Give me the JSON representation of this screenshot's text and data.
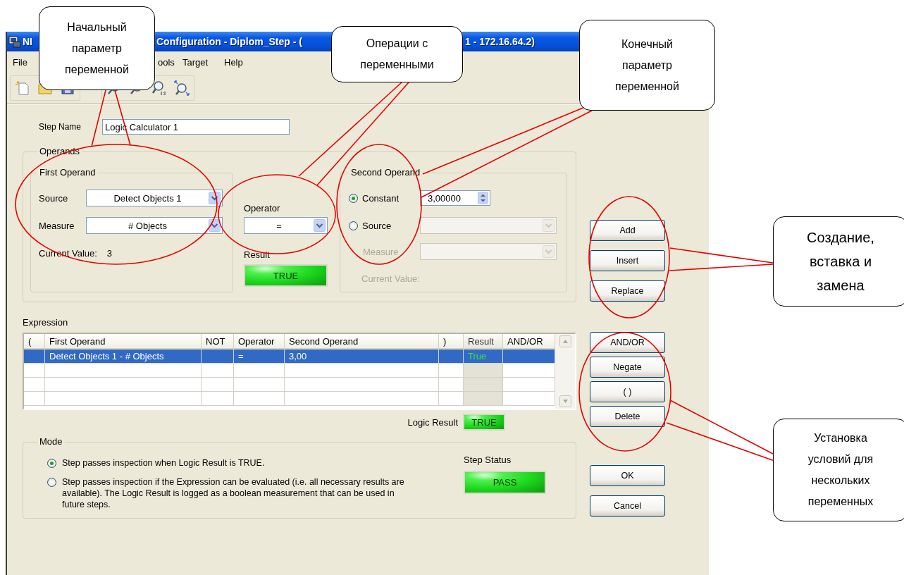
{
  "window": {
    "title_parts": [
      "NI",
      "Configuration - Diplom_Step - (",
      "1 - 172.16.64.2)"
    ]
  },
  "menu": [
    "File",
    "ools",
    "Target",
    "Help"
  ],
  "step_name": {
    "label": "Step Name",
    "value": "Logic Calculator 1"
  },
  "operands": {
    "title": "Operands",
    "first_operand": {
      "title": "First Operand",
      "source": {
        "label": "Source",
        "value": "Detect Objects 1"
      },
      "measure": {
        "label": "Measure",
        "value": "# Objects"
      },
      "current_value": {
        "label": "Current Value:",
        "value": "3"
      }
    },
    "operator": {
      "label": "Operator",
      "value": "="
    },
    "result": {
      "label": "Result",
      "value": "TRUE",
      "on": true
    },
    "second_operand": {
      "title": "Second Operand",
      "options": [
        {
          "label": "Constant",
          "selected": true
        },
        {
          "label": "Source",
          "selected": false
        }
      ],
      "constant": {
        "value": "3,00000"
      },
      "measure": {
        "label": "Measure"
      },
      "current_value": {
        "label": "Current Value:"
      }
    }
  },
  "expression": {
    "label": "Expression",
    "columns": [
      {
        "label": "(",
        "disabled": false
      },
      {
        "label": "First Operand",
        "disabled": false
      },
      {
        "label": "NOT",
        "disabled": false
      },
      {
        "label": "Operator",
        "disabled": false
      },
      {
        "label": "Second Operand",
        "disabled": false
      },
      {
        "label": ")",
        "disabled": false
      },
      {
        "label": "Result",
        "disabled": true
      },
      {
        "label": "AND/OR",
        "disabled": false
      }
    ],
    "rows": [
      {
        "selected": true,
        "cells": [
          null,
          "Detect Objects 1 - # Objects",
          null,
          "=",
          "3,00",
          null,
          "True",
          null
        ]
      }
    ]
  },
  "logic_result": {
    "label": "Logic Result",
    "value": "TRUE",
    "on": true
  },
  "mode": {
    "title": "Mode",
    "options": [
      {
        "text": "Step passes inspection when Logic Result is TRUE.",
        "selected": true
      },
      {
        "text": "Step passes inspection if the Expression can be evaluated (i.e. all necessary results are available). The Logic Result is logged as a boolean measurement that can be used in future steps.",
        "selected": false
      }
    ],
    "step_status": {
      "label": "Step Status",
      "value": "PASS",
      "on": true
    }
  },
  "button_groups": [
    [
      "Add",
      "Insert",
      "Replace"
    ],
    [
      "AND/OR",
      "Negate",
      "( )",
      "Delete"
    ],
    [
      "OK",
      "Cancel"
    ]
  ],
  "callouts": [
    {
      "text": "Начальный параметр переменной"
    },
    {
      "text": "Операции с переменными"
    },
    {
      "text": "Конечный параметр переменной"
    },
    {
      "text": "Создание, вставка и замена"
    },
    {
      "text": "Установка условий для нескольких переменных"
    }
  ]
}
